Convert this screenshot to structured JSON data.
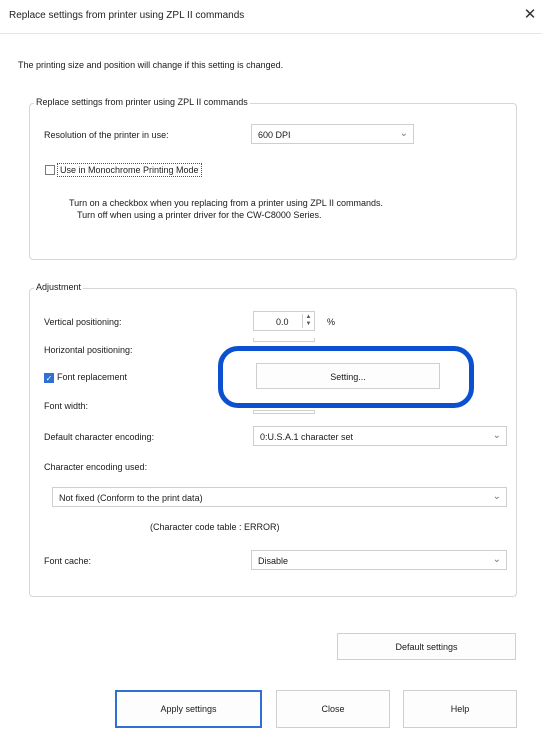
{
  "window": {
    "title": "Replace settings from printer using ZPL II commands",
    "close": "✕"
  },
  "notice": "The printing size and position will change if this setting is changed.",
  "replace_group": {
    "title": "Replace settings from printer using ZPL II commands",
    "resolution_label": "Resolution of the printer in use:",
    "resolution_value": "600 DPI",
    "monochrome_label": "Use in Monochrome Printing Mode",
    "monochrome_checked": false,
    "note_line1": "Turn on a checkbox when you replacing from a printer using ZPL II commands.",
    "note_line2": "Turn off when using a printer driver for the CW-C8000 Series."
  },
  "adjustment_group": {
    "title": "Adjustment",
    "vertical_label": "Vertical positioning:",
    "vertical_value": "0.0",
    "vertical_unit": "%",
    "horizontal_label": "Horizontal positioning:",
    "font_replacement_label": "Font replacement",
    "font_replacement_checked": true,
    "setting_button": "Setting...",
    "font_width_label": "Font width:",
    "default_encoding_label": "Default character encoding:",
    "default_encoding_value": "0:U.S.A.1 character set",
    "encoding_used_label": "Character encoding used:",
    "encoding_used_value": "Not fixed (Conform to the print data)",
    "code_table": "(Character code table : ERROR)",
    "font_cache_label": "Font cache:",
    "font_cache_value": "Disable"
  },
  "buttons": {
    "default_settings": "Default settings",
    "apply": "Apply settings",
    "close": "Close",
    "help": "Help"
  },
  "colors": {
    "highlight": "#0a50cf",
    "check_accent": "#2f6fd6"
  }
}
